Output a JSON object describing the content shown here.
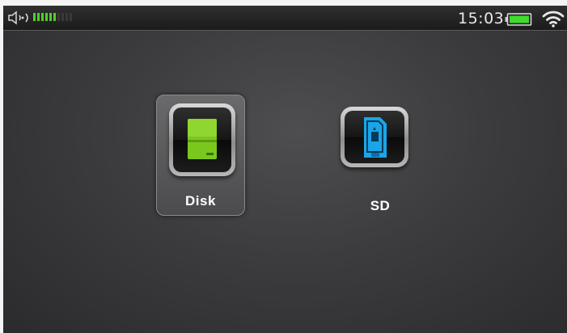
{
  "status_bar": {
    "time": "15:03",
    "volume_level": 0.6,
    "volume_segments": 10,
    "volume_on_color": "#4fcf2a",
    "battery_color": "#3fdc2c",
    "icons": [
      "speaker-icon",
      "battery-icon",
      "wifi-icon"
    ]
  },
  "storage_tiles": [
    {
      "label": "Disk",
      "icon": "hard-disk-icon",
      "selected": true,
      "icon_color": "#7ac81e"
    },
    {
      "label": "SD",
      "icon": "sd-card-icon",
      "selected": false,
      "icon_color": "#1aa5e8"
    }
  ]
}
